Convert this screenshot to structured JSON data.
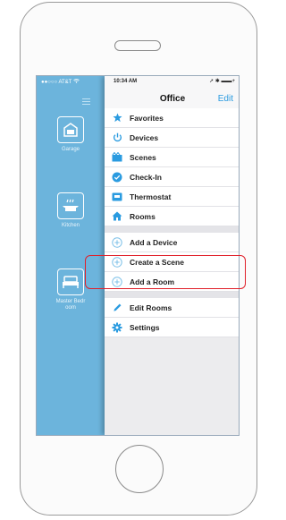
{
  "status_left": {
    "carrier": "●●○○○ AT&T",
    "wifi": "wifi-icon"
  },
  "status_right": {
    "time": "10:34 AM",
    "indicators": "➚ ✱ ▬▬+"
  },
  "nav": {
    "title": "Office",
    "edit_label": "Edit"
  },
  "rooms": [
    {
      "label": "Garage",
      "icon": "garage-icon"
    },
    {
      "label": "Kitchen",
      "icon": "kitchen-icon"
    },
    {
      "label": "Master Bedroom",
      "label_line1": "Master Bedr",
      "label_line2": "oom",
      "icon": "bed-icon"
    }
  ],
  "menu": {
    "favorites": "Favorites",
    "devices": "Devices",
    "scenes": "Scenes",
    "check_in": "Check-In",
    "thermostat": "Thermostat",
    "rooms": "Rooms",
    "add_device": "Add a Device",
    "create_scene": "Create a Scene",
    "add_room": "Add a Room",
    "edit_rooms": "Edit Rooms",
    "settings": "Settings"
  },
  "colors": {
    "accent": "#2a9be0",
    "sidebar": "#6cb4dc",
    "highlight": "#e0202a"
  }
}
